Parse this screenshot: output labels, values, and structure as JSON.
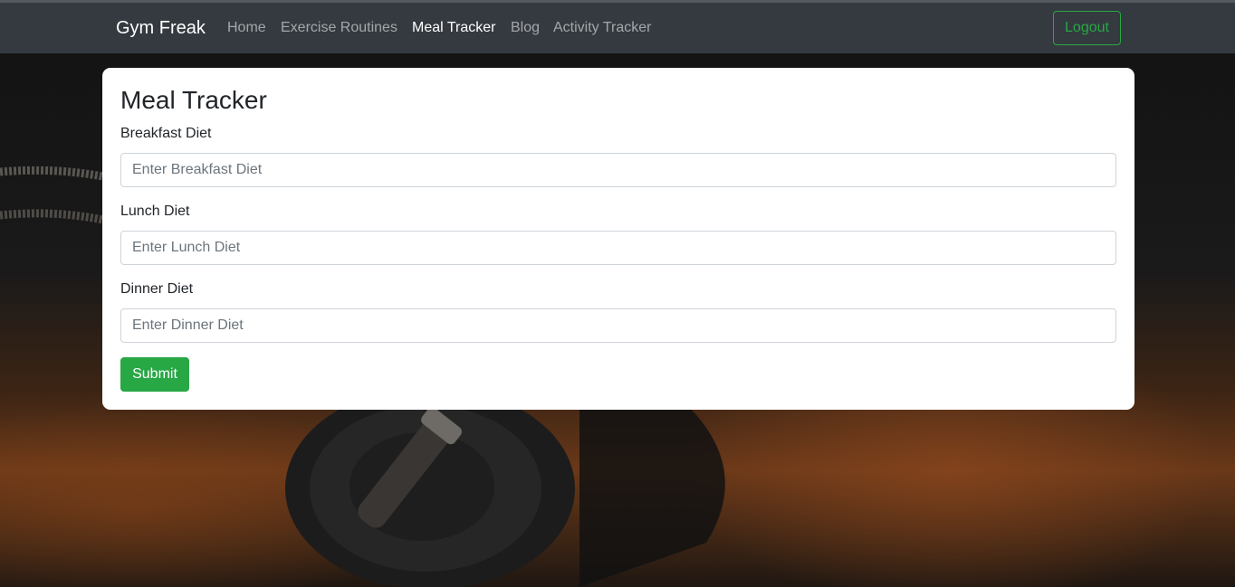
{
  "navbar": {
    "brand": "Gym Freak",
    "links": [
      {
        "label": "Home",
        "active": false
      },
      {
        "label": "Exercise Routines",
        "active": false
      },
      {
        "label": "Meal Tracker",
        "active": true
      },
      {
        "label": "Blog",
        "active": false
      },
      {
        "label": "Activity Tracker",
        "active": false
      }
    ],
    "logout_label": "Logout"
  },
  "form": {
    "title": "Meal Tracker",
    "fields": [
      {
        "label": "Breakfast Diet",
        "value": "",
        "placeholder": "Enter Breakfast Diet"
      },
      {
        "label": "Lunch Diet",
        "value": "",
        "placeholder": "Enter Lunch Diet"
      },
      {
        "label": "Dinner Diet",
        "value": "",
        "placeholder": "Enter Dinner Diet"
      }
    ],
    "submit_label": "Submit"
  },
  "colors": {
    "navbar_bg": "#343a40",
    "accent_green": "#28a745",
    "card_bg": "#ffffff"
  }
}
